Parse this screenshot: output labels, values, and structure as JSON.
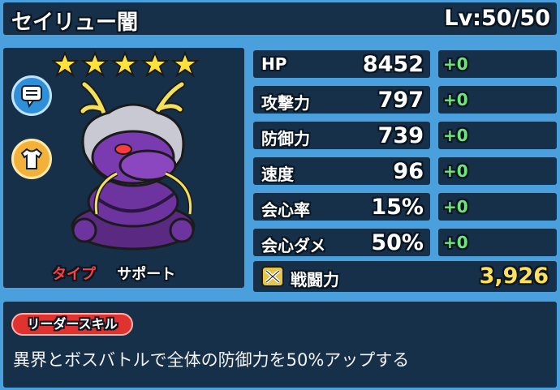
{
  "character": {
    "name": "セイリュー闇",
    "level": "Lv:50/50",
    "rarity_stars": 5,
    "type_label": "タイプ",
    "type_value": "サポート"
  },
  "stats": [
    {
      "label": "HP",
      "value": "8452",
      "bonus": "+0"
    },
    {
      "label": "攻撃力",
      "value": "797",
      "bonus": "+0"
    },
    {
      "label": "防御力",
      "value": "739",
      "bonus": "+0"
    },
    {
      "label": "速度",
      "value": "96",
      "bonus": "+0"
    },
    {
      "label": "会心率",
      "value": "15%",
      "bonus": "+0"
    },
    {
      "label": "会心ダメ",
      "value": "50%",
      "bonus": "+0"
    }
  ],
  "power": {
    "label": "戦闘力",
    "value": "3,926"
  },
  "leader_skill": {
    "badge": "リーダースキル",
    "description": "異界とボスバトルで全体の防御力を50%アップする"
  },
  "colors": {
    "background": "#4aa0dc",
    "panel": "#17304a",
    "bonus_green": "#6fe57a",
    "power_yellow": "#ffe05a",
    "type_red": "#ff4040",
    "badge_red": "#e0322f"
  }
}
